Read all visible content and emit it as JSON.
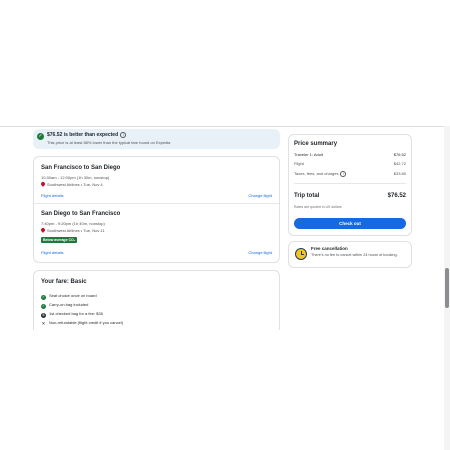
{
  "banner": {
    "title": "$76.52 is better than expected",
    "info_glyph": "i",
    "subtitle": "This price is at least 58% lower than the typical fare found on Expedia"
  },
  "flights": [
    {
      "route": "San Francisco to San Diego",
      "times": "10:30am - 12:00pm (1h 30m, nonstop)",
      "airline": "Southwest Airlines • Tue, Nov 4",
      "details_link": "Flight details",
      "change_link": "Change flight"
    },
    {
      "route": "San Diego to San Francisco",
      "times": "7:40pm - 9:20pm (1h 40m, nonstop)",
      "airline": "Southwest Airlines • Tue, Nov 11",
      "badge": "Below average CO₂",
      "details_link": "Flight details",
      "change_link": "Change flight"
    }
  ],
  "fare": {
    "title": "Your fare: Basic",
    "items": [
      {
        "text": "Seat choice once on board",
        "icon": "check-icon"
      },
      {
        "text": "Carry-on bag included",
        "icon": "check-icon"
      },
      {
        "text": "1st checked bag for a fee: $35",
        "icon": "dollar-icon"
      },
      {
        "text": "Non-refundable (flight credit if you cancel)",
        "icon": "x-icon"
      }
    ]
  },
  "summary": {
    "title": "Price summary",
    "traveler_label": "Traveler 1: Adult",
    "traveler_value": "$76.52",
    "flight_label": "Flight",
    "flight_value": "$42.72",
    "taxes_label": "Taxes, fees, and charges",
    "taxes_value": "$33.80",
    "total_label": "Trip total",
    "total_value": "$76.52",
    "currency_note": "Rates are quoted in US dollars",
    "checkout_label": "Check out"
  },
  "cancellation": {
    "title": "Free cancellation",
    "subtitle": "There's no fee to cancel within 24 hours of booking."
  },
  "colors": {
    "accent": "#1668e3",
    "success": "#1e7a3c",
    "banner_bg": "#e8f1f8",
    "airline_heart": "#c8102e",
    "clock_yellow": "#f5c518"
  }
}
